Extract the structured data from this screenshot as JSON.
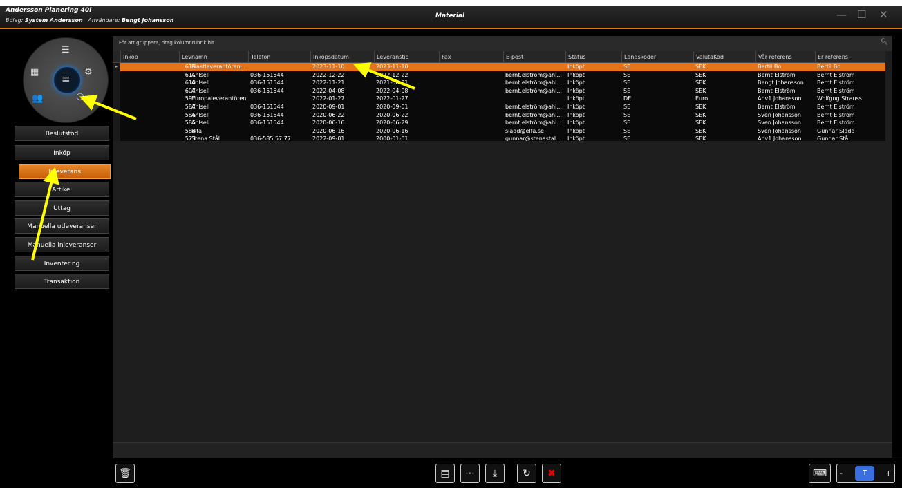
{
  "window": {
    "app_title": "Andersson Planering 40i",
    "company_label": "Bolag:",
    "company": "System Andersson",
    "user_label": "Användare:",
    "user": "Bengt Johansson",
    "title": "Material",
    "minimize": "—",
    "maximize": "☐",
    "close": "✕"
  },
  "sidebar": {
    "items": [
      {
        "label": "Beslutstöd",
        "active": false
      },
      {
        "label": "Inköp",
        "active": false
      },
      {
        "label": "Inleverans",
        "active": true
      },
      {
        "label": "Artikel",
        "active": false
      },
      {
        "label": "Uttag",
        "active": false
      },
      {
        "label": "Manuella utleveranser",
        "active": false
      },
      {
        "label": "Manuella inleveranser",
        "active": false
      },
      {
        "label": "Inventering",
        "active": false
      },
      {
        "label": "Transaktion",
        "active": false
      }
    ]
  },
  "grid": {
    "group_hint": "För att gruppera, drag kolumnrubrik hit",
    "columns": [
      "Inköp",
      "Levnamn",
      "Telefon",
      "Inköpsdatum",
      "Leveranstid",
      "Fax",
      "E-post",
      "Status",
      "Landskoder",
      "ValutaKod",
      "Vår referens",
      "Er referens"
    ],
    "rows": [
      [
        "615",
        "Plastleverantören...",
        "",
        "2023-11-10",
        "2023-11-10",
        "",
        "",
        "Inköpt",
        "SE",
        "SEK",
        "Bertil Bo",
        "Bertil Bo"
      ],
      [
        "611",
        "Ahlsell",
        "036-151544",
        "2022-12-22",
        "2022-12-22",
        "",
        "bernt.elström@ahl...",
        "Inköpt",
        "SE",
        "SEK",
        "Bernt Elström",
        "Bernt Elström"
      ],
      [
        "610",
        "Ahlsell",
        "036-151544",
        "2022-11-21",
        "2021-06-01",
        "",
        "bernt.elström@ahl...",
        "Inköpt",
        "SE",
        "SEK",
        "Bengt Johansson",
        "Bernt Elström"
      ],
      [
        "607",
        "Ahlsell",
        "036-151544",
        "2022-04-08",
        "2022-04-08",
        "",
        "bernt.elström@ahl...",
        "Inköpt",
        "SE",
        "SEK",
        "Bernt Elström",
        "Bernt Elström"
      ],
      [
        "597",
        "Europaleverantören",
        "",
        "2022-01-27",
        "2022-01-27",
        "",
        "",
        "Inköpt",
        "DE",
        "Euro",
        "Anv1 Johansson",
        "Wolfgng Strauss"
      ],
      [
        "587",
        "Ahlsell",
        "036-151544",
        "2020-09-01",
        "2020-09-01",
        "",
        "bernt.elström@ahl...",
        "Inköpt",
        "SE",
        "SEK",
        "Bernt Elström",
        "Bernt Elström"
      ],
      [
        "586",
        "Ahlsell",
        "036-151544",
        "2020-06-22",
        "2020-06-22",
        "",
        "bernt.elström@ahl...",
        "Inköpt",
        "SE",
        "SEK",
        "Sven Johansson",
        "Bernt Elström"
      ],
      [
        "585",
        "Ahlsell",
        "036-151544",
        "2020-06-16",
        "2020-06-29",
        "",
        "bernt.elström@ahl...",
        "Inköpt",
        "SE",
        "SEK",
        "Sven Johansson",
        "Bernt Elström"
      ],
      [
        "584",
        "Elfa",
        "",
        "2020-06-16",
        "2020-06-16",
        "",
        "sladd@elfa.se",
        "Inköpt",
        "SE",
        "SEK",
        "Sven Johansson",
        "Gunnar Sladd"
      ],
      [
        "573",
        "Stena Stål",
        "036-585 57 77",
        "2022-09-01",
        "2000-01-01",
        "",
        "gunnar@stenastal....",
        "Inköpt",
        "SE",
        "SEK",
        "Anv1 Johansson",
        "Gunnar  Stål"
      ]
    ]
  },
  "colors": {
    "accent": "#e5731a",
    "arrow": "#ffff00"
  }
}
